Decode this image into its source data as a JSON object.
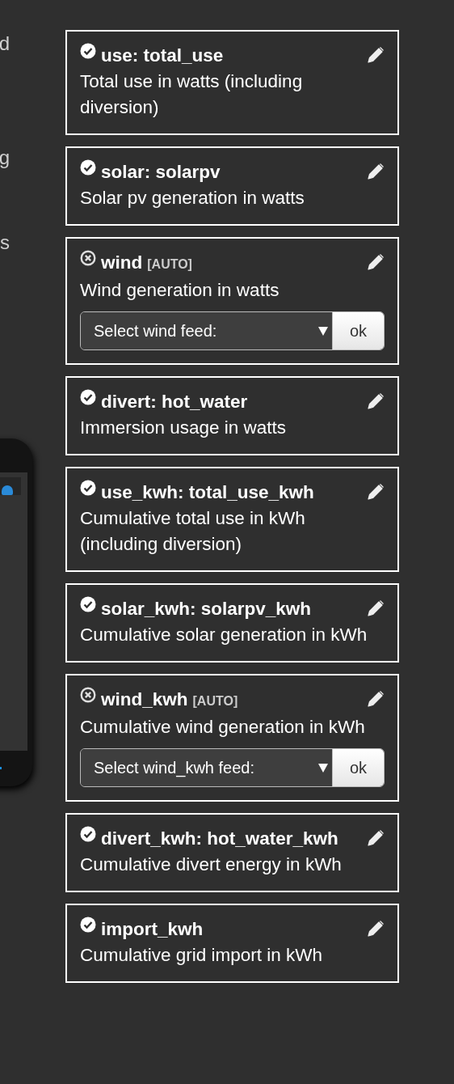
{
  "side_fragments": [
    "d",
    "g",
    "s"
  ],
  "feeds": [
    {
      "found": true,
      "title": "use: total_use",
      "description": "Total use in watts (including diversion)"
    },
    {
      "found": true,
      "title": "solar: solarpv",
      "description": "Solar pv generation in watts"
    },
    {
      "found": false,
      "title": "wind",
      "tag": "[AUTO]",
      "description": "Wind generation in watts",
      "select": {
        "placeholder": "Select wind feed:",
        "button": "ok"
      }
    },
    {
      "found": true,
      "title": "divert: hot_water",
      "description": "Immersion usage in watts"
    },
    {
      "found": true,
      "title": "use_kwh: total_use_kwh",
      "description": "Cumulative total use in kWh (including diversion)"
    },
    {
      "found": true,
      "title": "solar_kwh: solarpv_kwh",
      "description": "Cumulative solar generation in kWh"
    },
    {
      "found": false,
      "title": "wind_kwh",
      "tag": "[AUTO]",
      "description": "Cumulative wind generation in kWh",
      "select": {
        "placeholder": "Select wind_kwh feed:",
        "button": "ok"
      }
    },
    {
      "found": true,
      "title": "divert_kwh: hot_water_kwh",
      "description": "Cumulative divert energy in kWh"
    },
    {
      "found": true,
      "title": "import_kwh",
      "description": "Cumulative grid import in kWh"
    }
  ]
}
